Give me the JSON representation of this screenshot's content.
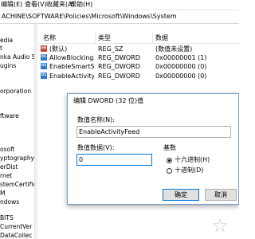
{
  "menu": {
    "items": [
      "编辑(E)",
      "查看(V)",
      "收藏夹(A)",
      "帮助(H)"
    ]
  },
  "address": {
    "path": "ACHINE\\SOFTWARE\\Policies\\Microsoft\\Windows\\System"
  },
  "tree": {
    "items": [
      "edia",
      "t",
      "nka Audio S",
      "ugins",
      "orporation",
      "ftware",
      "osoft",
      "yptography",
      "erDist",
      "rnet",
      "stemCertific",
      "M",
      "ndows",
      "BITS",
      "CurrentVer",
      "DataCollec"
    ]
  },
  "list": {
    "columns": [
      "名称",
      "类型",
      "数据"
    ],
    "rows": [
      {
        "icon": "string-value-icon",
        "icon_text": "ab",
        "name": "(默认)",
        "type": "REG_SZ",
        "data": "(数值未设置)"
      },
      {
        "icon": "dword-value-icon",
        "icon_text": "01",
        "name": "AllowBlockingA...",
        "type": "REG_DWORD",
        "data": "0x00000001 (1)"
      },
      {
        "icon": "dword-value-icon",
        "icon_text": "01",
        "name": "EnableSmartScr",
        "type": "REG_DWORD",
        "data": "0x00000000 (0)"
      },
      {
        "icon": "dword-value-icon",
        "icon_text": "01",
        "name": "EnableActivityFe",
        "type": "REG_DWORD",
        "data": "0x00000000 (0)"
      }
    ]
  },
  "dialog": {
    "title": "编辑 DWORD (32 位)值",
    "value_name_label": "数值名称(N):",
    "value_name": "EnableActivityFeed",
    "value_data_label": "数值数据(V):",
    "value_data": "0",
    "base_label": "基数",
    "hex_label": "十六进制(H)",
    "dec_label": "十进制(D)",
    "base_selected": "十六进制(H)",
    "ok_label": "确定",
    "cancel_label": "取消"
  },
  "colors": {
    "dialog_border": "#7a9ccc",
    "accent": "#0078d7",
    "string_icon": "#c2463e",
    "dword_icon": "#2e7cc2"
  }
}
